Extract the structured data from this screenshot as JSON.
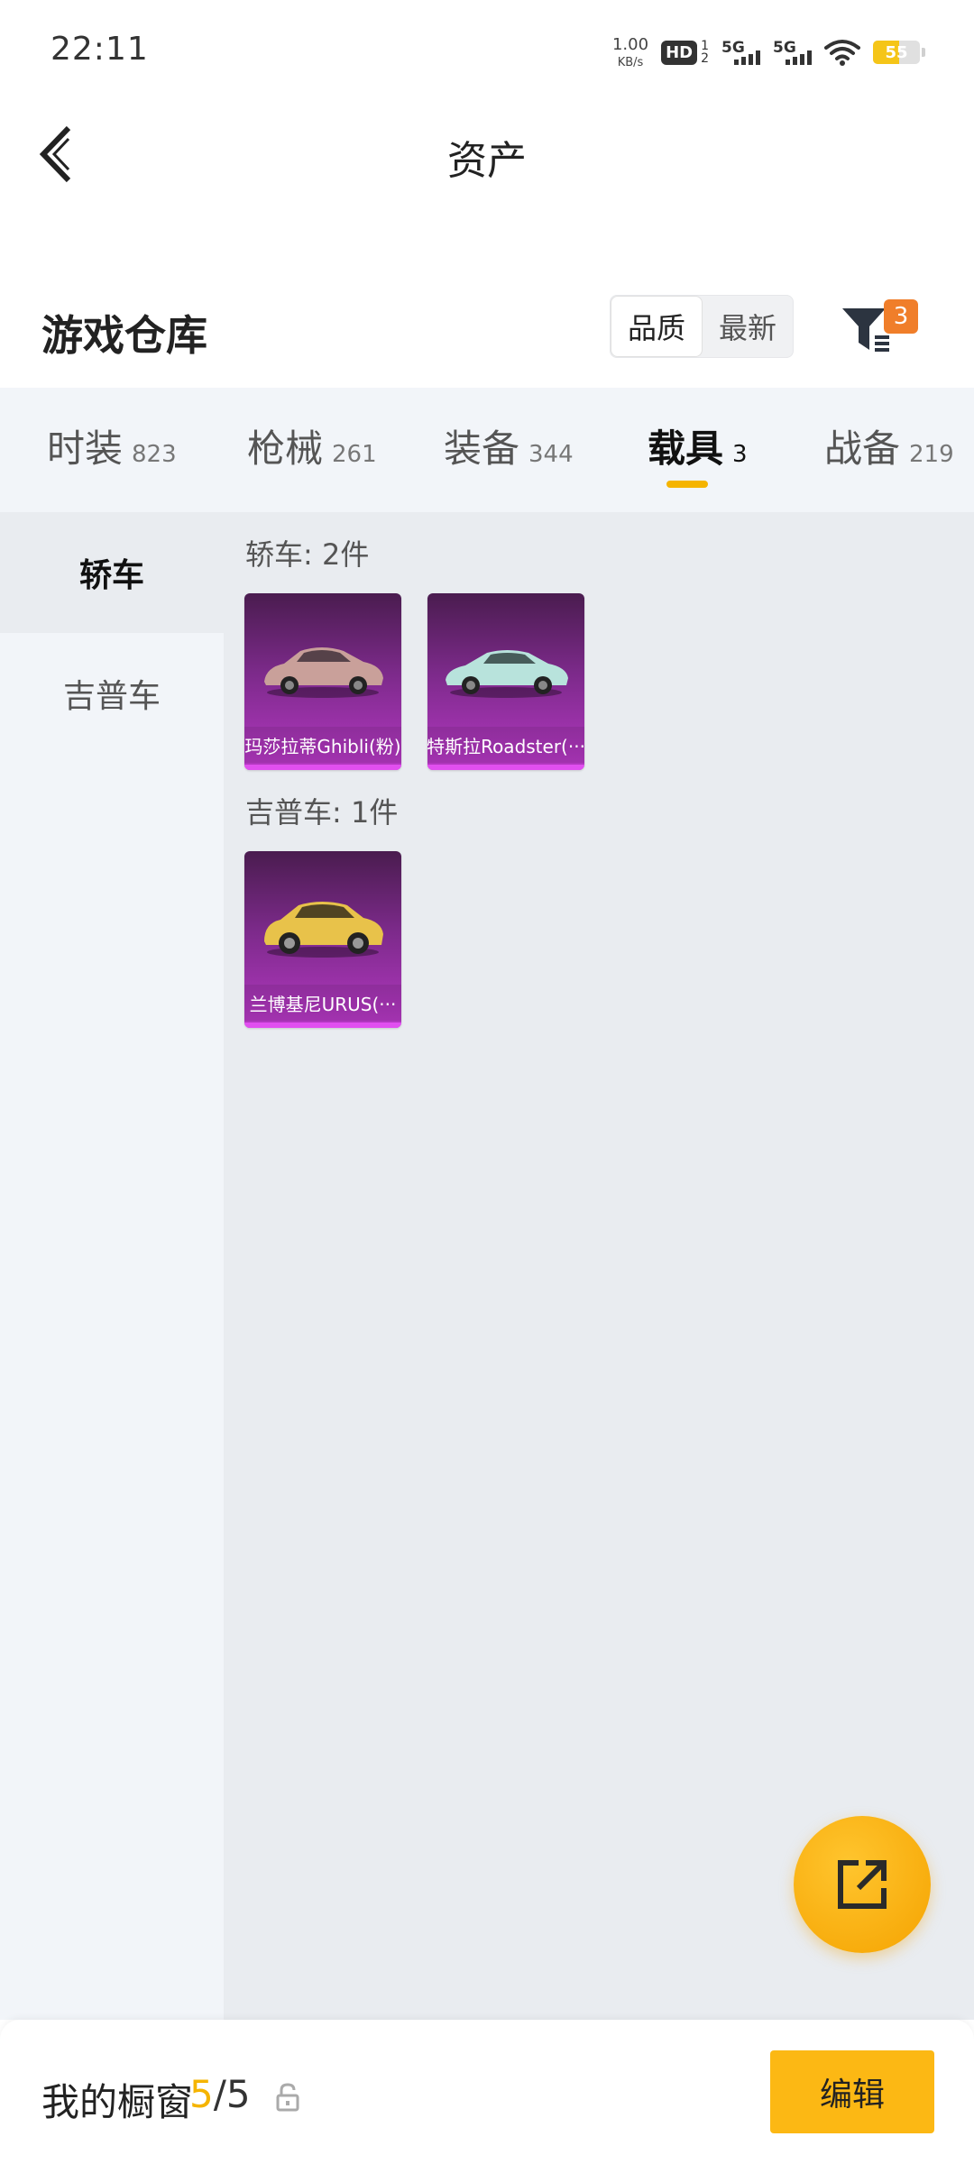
{
  "status_bar": {
    "time": "22:11",
    "net_speed_value": "1.00",
    "net_speed_unit": "KB/s",
    "hd_label": "HD",
    "hd_sub_top": "1",
    "hd_sub_bottom": "2",
    "sim1_label": "5G",
    "sim2_label": "5G",
    "battery_level": "55",
    "battery_fill": 0.55
  },
  "header": {
    "title": "资产"
  },
  "warehouse": {
    "title": "游戏仓库",
    "sort_quality": "品质",
    "sort_latest": "最新",
    "filter_badge": "3"
  },
  "tabs": [
    {
      "label": "时装",
      "count": "823"
    },
    {
      "label": "枪械",
      "count": "261"
    },
    {
      "label": "装备",
      "count": "344"
    },
    {
      "label": "载具",
      "count": "3"
    },
    {
      "label": "战备",
      "count": "219"
    }
  ],
  "sidebar": {
    "items": [
      {
        "label": "轿车"
      },
      {
        "label": "吉普车"
      }
    ]
  },
  "sections": [
    {
      "label": "轿车: 2件",
      "items": [
        {
          "name": "玛莎拉蒂Ghibli(粉)",
          "car_color": "#c9a09a"
        },
        {
          "name": "特斯拉Roadster(···",
          "car_color": "#b8e3dc"
        }
      ]
    },
    {
      "label": "吉普车: 1件",
      "items": [
        {
          "name": "兰博基尼URUS(···",
          "car_color": "#e8c24a"
        }
      ]
    }
  ],
  "bottom_bar": {
    "my_window_label": "我的橱窗",
    "count_current": "5",
    "count_total": "/5",
    "edit_label": "编辑"
  }
}
